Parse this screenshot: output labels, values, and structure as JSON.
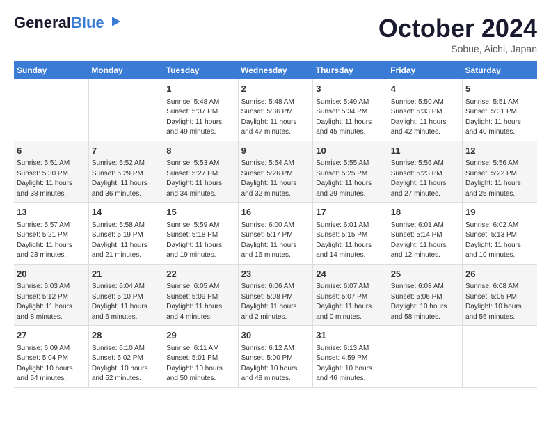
{
  "logo": {
    "name_part1": "General",
    "name_part2": "Blue",
    "tagline": "Blue"
  },
  "title": {
    "month": "October 2024",
    "location": "Sobue, Aichi, Japan"
  },
  "days_of_week": [
    "Sunday",
    "Monday",
    "Tuesday",
    "Wednesday",
    "Thursday",
    "Friday",
    "Saturday"
  ],
  "weeks": [
    [
      {
        "day": "",
        "content": ""
      },
      {
        "day": "",
        "content": ""
      },
      {
        "day": "1",
        "content": "Sunrise: 5:48 AM\nSunset: 5:37 PM\nDaylight: 11 hours and 49 minutes."
      },
      {
        "day": "2",
        "content": "Sunrise: 5:48 AM\nSunset: 5:36 PM\nDaylight: 11 hours and 47 minutes."
      },
      {
        "day": "3",
        "content": "Sunrise: 5:49 AM\nSunset: 5:34 PM\nDaylight: 11 hours and 45 minutes."
      },
      {
        "day": "4",
        "content": "Sunrise: 5:50 AM\nSunset: 5:33 PM\nDaylight: 11 hours and 42 minutes."
      },
      {
        "day": "5",
        "content": "Sunrise: 5:51 AM\nSunset: 5:31 PM\nDaylight: 11 hours and 40 minutes."
      }
    ],
    [
      {
        "day": "6",
        "content": "Sunrise: 5:51 AM\nSunset: 5:30 PM\nDaylight: 11 hours and 38 minutes."
      },
      {
        "day": "7",
        "content": "Sunrise: 5:52 AM\nSunset: 5:29 PM\nDaylight: 11 hours and 36 minutes."
      },
      {
        "day": "8",
        "content": "Sunrise: 5:53 AM\nSunset: 5:27 PM\nDaylight: 11 hours and 34 minutes."
      },
      {
        "day": "9",
        "content": "Sunrise: 5:54 AM\nSunset: 5:26 PM\nDaylight: 11 hours and 32 minutes."
      },
      {
        "day": "10",
        "content": "Sunrise: 5:55 AM\nSunset: 5:25 PM\nDaylight: 11 hours and 29 minutes."
      },
      {
        "day": "11",
        "content": "Sunrise: 5:56 AM\nSunset: 5:23 PM\nDaylight: 11 hours and 27 minutes."
      },
      {
        "day": "12",
        "content": "Sunrise: 5:56 AM\nSunset: 5:22 PM\nDaylight: 11 hours and 25 minutes."
      }
    ],
    [
      {
        "day": "13",
        "content": "Sunrise: 5:57 AM\nSunset: 5:21 PM\nDaylight: 11 hours and 23 minutes."
      },
      {
        "day": "14",
        "content": "Sunrise: 5:58 AM\nSunset: 5:19 PM\nDaylight: 11 hours and 21 minutes."
      },
      {
        "day": "15",
        "content": "Sunrise: 5:59 AM\nSunset: 5:18 PM\nDaylight: 11 hours and 19 minutes."
      },
      {
        "day": "16",
        "content": "Sunrise: 6:00 AM\nSunset: 5:17 PM\nDaylight: 11 hours and 16 minutes."
      },
      {
        "day": "17",
        "content": "Sunrise: 6:01 AM\nSunset: 5:15 PM\nDaylight: 11 hours and 14 minutes."
      },
      {
        "day": "18",
        "content": "Sunrise: 6:01 AM\nSunset: 5:14 PM\nDaylight: 11 hours and 12 minutes."
      },
      {
        "day": "19",
        "content": "Sunrise: 6:02 AM\nSunset: 5:13 PM\nDaylight: 11 hours and 10 minutes."
      }
    ],
    [
      {
        "day": "20",
        "content": "Sunrise: 6:03 AM\nSunset: 5:12 PM\nDaylight: 11 hours and 8 minutes."
      },
      {
        "day": "21",
        "content": "Sunrise: 6:04 AM\nSunset: 5:10 PM\nDaylight: 11 hours and 6 minutes."
      },
      {
        "day": "22",
        "content": "Sunrise: 6:05 AM\nSunset: 5:09 PM\nDaylight: 11 hours and 4 minutes."
      },
      {
        "day": "23",
        "content": "Sunrise: 6:06 AM\nSunset: 5:08 PM\nDaylight: 11 hours and 2 minutes."
      },
      {
        "day": "24",
        "content": "Sunrise: 6:07 AM\nSunset: 5:07 PM\nDaylight: 11 hours and 0 minutes."
      },
      {
        "day": "25",
        "content": "Sunrise: 6:08 AM\nSunset: 5:06 PM\nDaylight: 10 hours and 58 minutes."
      },
      {
        "day": "26",
        "content": "Sunrise: 6:08 AM\nSunset: 5:05 PM\nDaylight: 10 hours and 56 minutes."
      }
    ],
    [
      {
        "day": "27",
        "content": "Sunrise: 6:09 AM\nSunset: 5:04 PM\nDaylight: 10 hours and 54 minutes."
      },
      {
        "day": "28",
        "content": "Sunrise: 6:10 AM\nSunset: 5:02 PM\nDaylight: 10 hours and 52 minutes."
      },
      {
        "day": "29",
        "content": "Sunrise: 6:11 AM\nSunset: 5:01 PM\nDaylight: 10 hours and 50 minutes."
      },
      {
        "day": "30",
        "content": "Sunrise: 6:12 AM\nSunset: 5:00 PM\nDaylight: 10 hours and 48 minutes."
      },
      {
        "day": "31",
        "content": "Sunrise: 6:13 AM\nSunset: 4:59 PM\nDaylight: 10 hours and 46 minutes."
      },
      {
        "day": "",
        "content": ""
      },
      {
        "day": "",
        "content": ""
      }
    ]
  ]
}
